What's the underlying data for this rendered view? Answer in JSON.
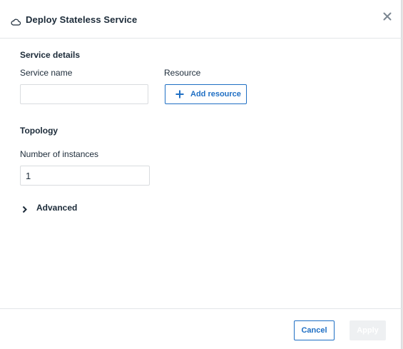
{
  "dialog": {
    "title": "Deploy Stateless Service",
    "icons": {
      "title_icon": "cloud-icon",
      "close": "close-icon"
    }
  },
  "service_details": {
    "heading": "Service details",
    "service_name": {
      "label": "Service name",
      "value": ""
    },
    "resource": {
      "label": "Resource",
      "add_button": "Add resource",
      "icon": "plus-icon"
    }
  },
  "topology": {
    "heading": "Topology",
    "instances": {
      "label": "Number of instances",
      "value": "1"
    }
  },
  "advanced": {
    "label": "Advanced",
    "expanded": false,
    "icon": "chevron-right-icon"
  },
  "footer": {
    "cancel_label": "Cancel",
    "apply_label": "Apply",
    "apply_enabled": false
  },
  "colors": {
    "accent": "#1f6fc4",
    "text": "#1c2b39",
    "border": "#d9dcdf",
    "disabled_bg": "#eef0f2"
  }
}
